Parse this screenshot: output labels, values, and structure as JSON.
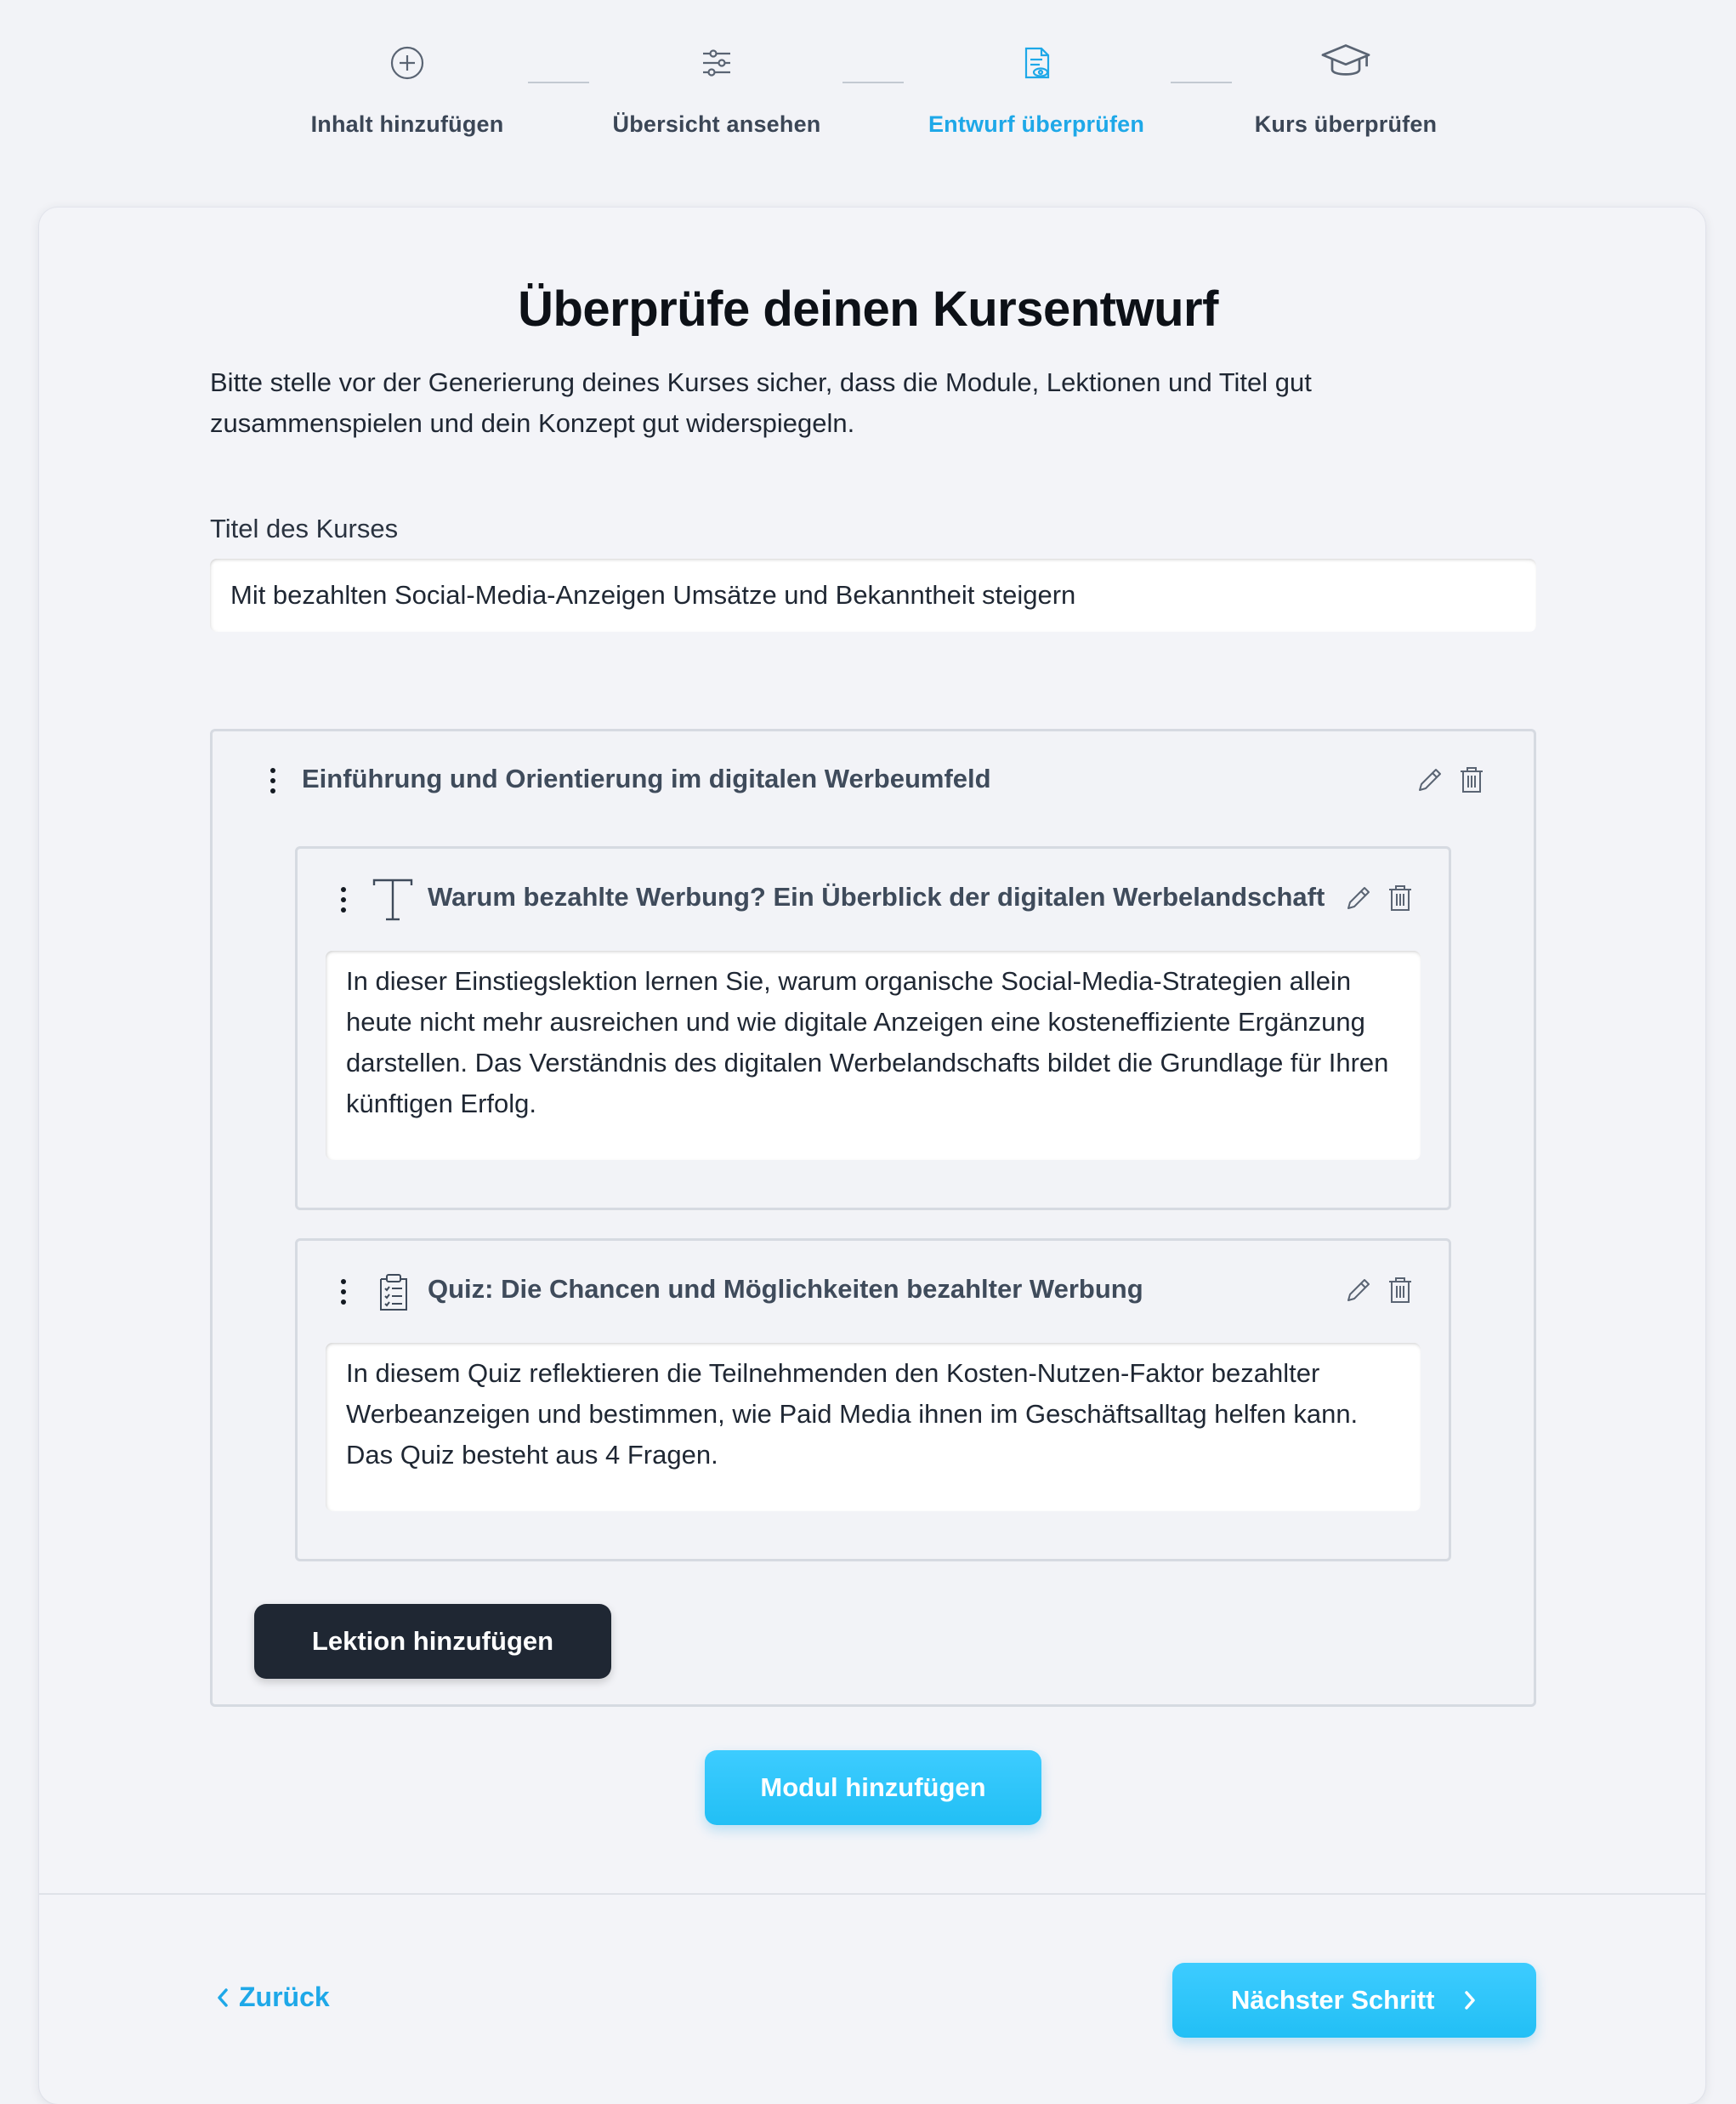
{
  "stepper": {
    "steps": [
      {
        "label": "Inhalt hinzufügen",
        "icon": "plus-circle-icon",
        "active": false
      },
      {
        "label": "Übersicht ansehen",
        "icon": "sliders-icon",
        "active": false
      },
      {
        "label": "Entwurf überprüfen",
        "icon": "document-review-icon",
        "active": true
      },
      {
        "label": "Kurs überprüfen",
        "icon": "graduation-cap-icon",
        "active": false
      }
    ],
    "active_color": "#1ea8e8"
  },
  "page": {
    "title": "Überprüfe deinen Kursentwurf",
    "intro": "Bitte stelle vor der Generierung deines Kurses sicher, dass die Module, Lektionen und Titel gut zusammenspielen und dein Konzept gut widerspiegeln."
  },
  "course": {
    "title_label": "Titel des Kurses",
    "title_value": "Mit bezahlten Social-Media-Anzeigen Umsätze und Bekanntheit steigern"
  },
  "module": {
    "title": "Einführung und Orientierung im digitalen Werbeumfeld",
    "lessons": [
      {
        "type_icon": "text-icon",
        "title": "Warum bezahlte Werbung? Ein Überblick der digitalen Werbelandschaft",
        "description": "In dieser Einstiegslektion lernen Sie, warum organische Social-Media-Strategien allein heute nicht mehr ausreichen und wie digitale Anzeigen eine kosteneffiziente Ergänzung darstellen. Das Verständnis des digitalen Werbelandschafts bildet die Grundlage für Ihren künftigen Erfolg."
      },
      {
        "type_icon": "quiz-icon",
        "title": "Quiz: Die Chancen und Möglichkeiten bezahlter Werbung",
        "description": "In diesem Quiz reflektieren die Teilnehmenden den Kosten-Nutzen-Faktor bezahlter Werbeanzeigen und bestimmen, wie Paid Media ihnen im Geschäftsalltag helfen kann. Das Quiz besteht aus 4 Fragen."
      }
    ],
    "add_lesson_label": "Lektion hinzufügen"
  },
  "actions": {
    "add_module_label": "Modul hinzufügen",
    "back_label": "Zurück",
    "next_label": "Nächster Schritt"
  }
}
